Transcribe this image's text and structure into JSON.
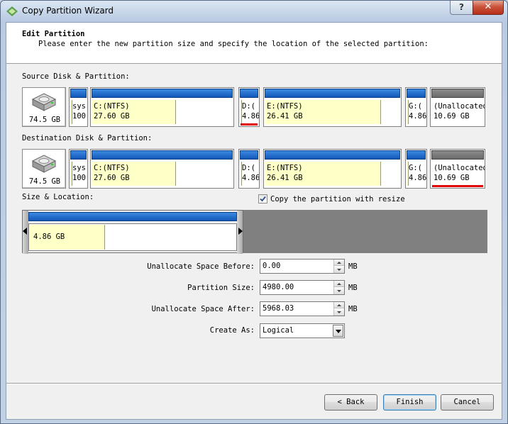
{
  "window": {
    "title": "Copy Partition Wizard",
    "help_label": "?",
    "close_label": "✕"
  },
  "header": {
    "title": "Edit Partition",
    "subtitle": "Please enter the new partition size and specify the location of the selected partition:"
  },
  "source": {
    "label": "Source Disk & Partition:",
    "disk_size": "74.5 GB",
    "partitions": [
      {
        "line1": "sys",
        "line2": "100"
      },
      {
        "line1": "C:(NTFS)",
        "line2": "27.60 GB"
      },
      {
        "line1": "D:(",
        "line2": "4.86"
      },
      {
        "line1": "E:(NTFS)",
        "line2": "26.41 GB"
      },
      {
        "line1": "G:(",
        "line2": "4.86"
      },
      {
        "line1": "(Unallocated)",
        "line2": "10.69 GB"
      }
    ]
  },
  "destination": {
    "label": "Destination Disk & Partition:",
    "disk_size": "74.5 GB",
    "partitions": [
      {
        "line1": "sys",
        "line2": "100"
      },
      {
        "line1": "C:(NTFS)",
        "line2": "27.60 GB"
      },
      {
        "line1": "D:(",
        "line2": "4.86"
      },
      {
        "line1": "E:(NTFS)",
        "line2": "26.41 GB"
      },
      {
        "line1": "G:(",
        "line2": "4.86"
      },
      {
        "line1": "(Unallocated)",
        "line2": "10.69 GB"
      }
    ]
  },
  "size_location": {
    "label": "Size & Location:",
    "partition_size": "4.86 GB",
    "copy_with_resize": {
      "label": "Copy the partition with resize",
      "checked": true
    }
  },
  "fields": {
    "unallocated_before": {
      "label": "Unallocate Space Before:",
      "value": "0.00",
      "unit": "MB"
    },
    "partition_size": {
      "label": "Partition Size:",
      "value": "4980.00",
      "unit": "MB"
    },
    "unallocated_after": {
      "label": "Unallocate Space After:",
      "value": "5968.03",
      "unit": "MB"
    },
    "create_as": {
      "label": "Create As:",
      "value": "Logical"
    }
  },
  "buttons": {
    "back": "< Back",
    "finish": "Finish",
    "cancel": "Cancel"
  },
  "icons": {
    "window": "wizard-icon",
    "disk": "hard-disk-icon",
    "check": "checkmark-icon"
  }
}
